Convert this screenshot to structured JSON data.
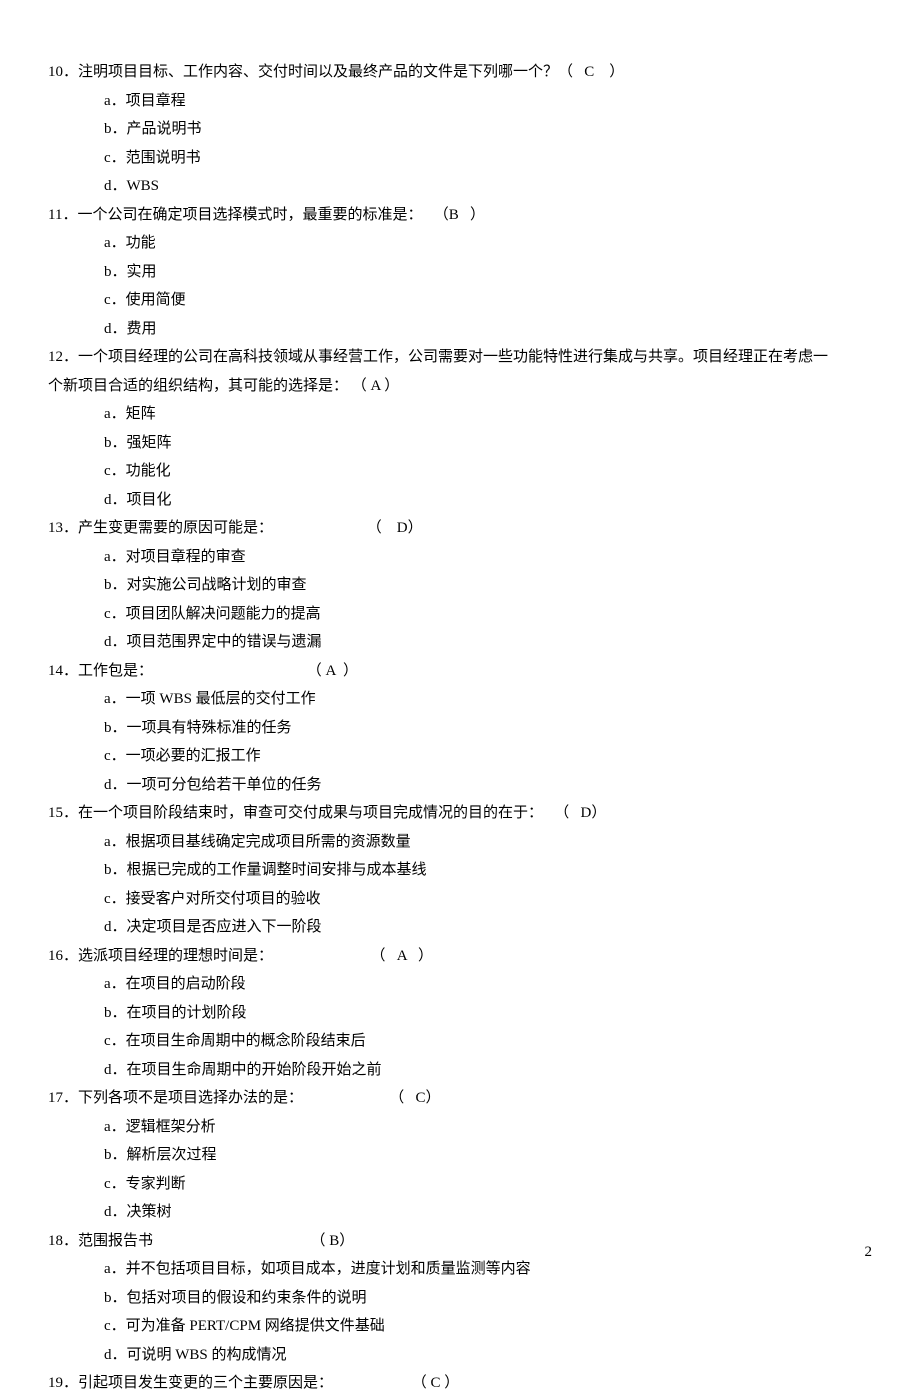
{
  "questions": [
    {
      "num": "10．",
      "text": "注明项目目标、工作内容、交付时间以及最终产品的文件是下列哪一个？",
      "ans": "（   C    ）",
      "opts": [
        "a．项目章程",
        "b．产品说明书",
        "c．范围说明书",
        "d．WBS"
      ]
    },
    {
      "num": "11．",
      "text": "一个公司在确定项目选择模式时，最重要的标准是：",
      "ans": "   （B   ）",
      "opts": [
        "a．功能",
        "b．实用",
        "c．使用简便",
        "d．费用"
      ]
    },
    {
      "num": "12．",
      "text": "一个项目经理的公司在高科技领域从事经营工作，公司需要对一些功能特性进行集成与共享。项目经理正在考虑一",
      "text2": "个新项目合适的组织结构，其可能的选择是：",
      "ans": "     （ A   ）",
      "opts": [
        "a．矩阵",
        "b．强矩阵",
        "c．功能化",
        "d．项目化"
      ]
    },
    {
      "num": "13．",
      "text": "产生变更需要的原因可能是：",
      "ans": "                         （    D）",
      "opts": [
        "a．对项目章程的审查",
        "b．对实施公司战略计划的审查",
        "c．项目团队解决问题能力的提高",
        "d．项目范围界定中的错误与遗漏"
      ]
    },
    {
      "num": "14．",
      "text": "工作包是：",
      "ans": "                                         （ A  ）",
      "opts": [
        "a．一项 WBS 最低层的交付工作",
        "b．一项具有特殊标准的任务",
        "c．一项必要的汇报工作",
        "d．一项可分包给若干单位的任务"
      ]
    },
    {
      "num": "15．",
      "text": "在一个项目阶段结束时，审查可交付成果与项目完成情况的目的在于：",
      "ans": "   （   D）",
      "opts": [
        "a．根据项目基线确定完成项目所需的资源数量",
        "b．根据已完成的工作量调整时间安排与成本基线",
        "c．接受客户对所交付项目的验收",
        "d．决定项目是否应进入下一阶段"
      ]
    },
    {
      "num": "16．",
      "text": "选派项目经理的理想时间是：",
      "ans": "                          （   A   ）",
      "opts": [
        "a．在项目的启动阶段",
        "b．在项目的计划阶段",
        "c．在项目生命周期中的概念阶段结束后",
        "d．在项目生命周期中的开始阶段开始之前"
      ]
    },
    {
      "num": "17．",
      "text": "下列各项不是项目选择办法的是：",
      "ans": "                       （   C）",
      "opts": [
        "a．逻辑框架分析",
        "b．解析层次过程",
        "c．专家判断",
        "d．决策树"
      ]
    },
    {
      "num": "18．",
      "text": "范围报告书",
      "ans": "                                          （ B）",
      "opts": [
        "a．并不包括项目目标，如项目成本，进度计划和质量监测等内容",
        "b．包括对项目的假设和约束条件的说明",
        "c．可为准备 PERT/CPM 网络提供文件基础",
        "d．可说明 WBS 的构成情况"
      ]
    },
    {
      "num": "19．",
      "text": "引起项目发生变更的三个主要原因是：",
      "ans": "                     （ C ）",
      "opts": []
    }
  ],
  "page_number": "2"
}
